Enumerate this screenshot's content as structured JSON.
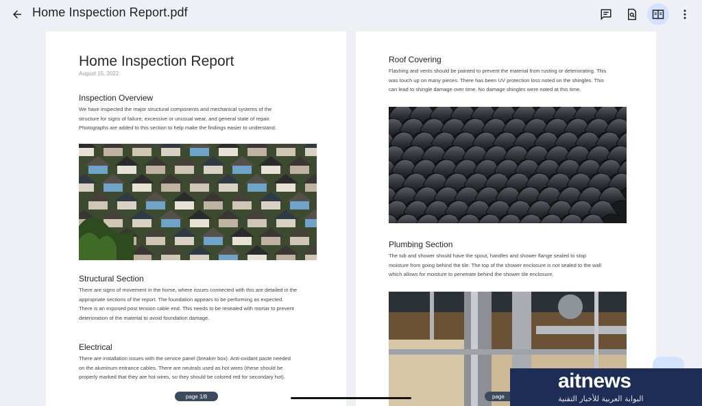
{
  "app": {
    "title": "Home Inspection Report.pdf",
    "icons": [
      "arrow-back-icon",
      "comment-icon",
      "search-document-icon",
      "two-page-view-icon",
      "more-vert-icon"
    ],
    "accent_color": "#d3e3fd"
  },
  "left_page": {
    "title": "Home Inspection Report",
    "date": "August 15, 2022",
    "sections": [
      {
        "heading": "Inspection Overview",
        "lines": [
          "We have inspected the major structural components and mechanical systems of the",
          "structure for signs of failure, excessive or unusual wear, and general state of repair.",
          "Photographs are added to this section to help make the findings easier to understand."
        ]
      },
      {
        "heading": "Structural Section",
        "lines": [
          "There are signs of movement in the home, where issues connected with this are detailed in the",
          "appropriate sections of the report. The foundation appears to be performing as expected.",
          "There is an exposed post tension cable end. This needs to be resealed with mortar to prevent",
          "deterioration of the material to avoid foundation damage."
        ]
      },
      {
        "heading": "Electrical",
        "lines": [
          "There are installation issues with the service panel (breaker box). Anti-oxidant paste needed",
          "on the aluminum entrance cables. There are neutrals used as hot wires (these should be",
          "properly marked that they are hot wires, so they should be colored red for secondary hot)."
        ]
      }
    ],
    "page_label": "page 1/8"
  },
  "right_page": {
    "sections": [
      {
        "heading": "Roof Covering",
        "lines": [
          "Flashing and vents should be painted to prevent the material from rusting or deteriorating. This",
          "was touch up on many pieces. There has been UV protection loss noted on the shingles. This",
          "can lead to shingle damage over time. No damage shingles were noted at this time."
        ]
      },
      {
        "heading": "Plumbing Section",
        "lines": [
          "The tub and shower should have the spout, handles and shower flange sealed to stop",
          "moisture from going behind the tile. The top of the shower enclosure is not sealed to the wall",
          "which allows for moisture to penetrate behind the shower tile enclosure."
        ]
      }
    ],
    "page_label": "page"
  },
  "watermark": {
    "name": "aitnews",
    "tagline": "البوابة العربية للأخبار التقنية"
  }
}
